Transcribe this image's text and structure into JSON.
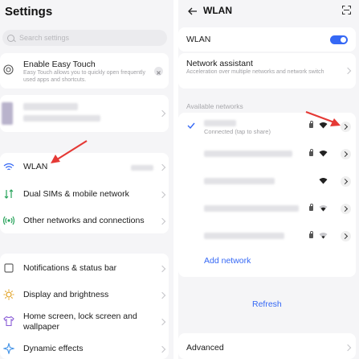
{
  "left": {
    "title": "Settings",
    "search_placeholder": "Search settings",
    "easy_touch": {
      "title": "Enable Easy Touch",
      "description": "Easy Touch allows you to quickly open frequently used apps and shortcuts."
    },
    "items": [
      {
        "label": "WLAN",
        "icon": "wifi-icon"
      },
      {
        "label": "Dual SIMs & mobile network",
        "icon": "dual-sim-icon"
      },
      {
        "label": "Other networks and connections",
        "icon": "connections-icon"
      },
      {
        "label": "Notifications & status bar",
        "icon": "notifications-icon"
      },
      {
        "label": "Display and brightness",
        "icon": "brightness-icon"
      },
      {
        "label": "Home screen, lock screen and wallpaper",
        "icon": "shirt-icon"
      },
      {
        "label": "Dynamic effects",
        "icon": "effects-icon"
      }
    ]
  },
  "right": {
    "title": "WLAN",
    "wlan_label": "WLAN",
    "wlan_enabled": true,
    "assistant": {
      "title": "Network assistant",
      "description": "Acceleration over multiple networks and network switch"
    },
    "available_label": "Available networks",
    "connected_status": "Connected (tap to share)",
    "add_network": "Add network",
    "refresh": "Refresh",
    "advanced": "Advanced"
  },
  "colors": {
    "accent": "#3568f5",
    "arrow": "#e53935",
    "background": "#f5f5f7",
    "card": "#ffffff"
  }
}
